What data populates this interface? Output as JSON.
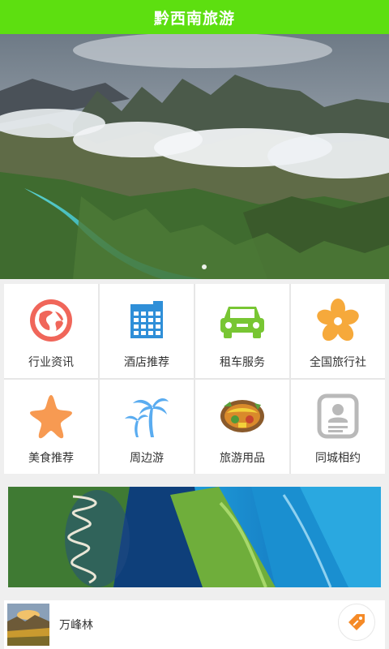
{
  "header": {
    "title": "黔西南旅游"
  },
  "banner": {
    "pager_active": 1
  },
  "categories": [
    {
      "label": "行业资讯",
      "icon": "globe-icon"
    },
    {
      "label": "酒店推荐",
      "icon": "hotel-building-icon"
    },
    {
      "label": "租车服务",
      "icon": "car-icon"
    },
    {
      "label": "全国旅行社",
      "icon": "flower-icon"
    },
    {
      "label": "美食推荐",
      "icon": "starfish-icon"
    },
    {
      "label": "周边游",
      "icon": "palm-tree-icon"
    },
    {
      "label": "旅游用品",
      "icon": "travel-goods-icon"
    },
    {
      "label": "同城相约",
      "icon": "id-card-icon"
    }
  ],
  "list": [
    {
      "title": "万峰林",
      "thumb": "landscape-thumbnail",
      "action_icon": "price-tag-icon"
    }
  ],
  "colors": {
    "header_bg": "#5ddf10",
    "globe": "#f0665a",
    "hotel": "#2f8fd8",
    "car": "#78c633",
    "flower": "#f6a93b",
    "starfish": "#f79a52",
    "palm": "#5aacf0",
    "idcard": "#b9b9b9",
    "tag": "#f58a27"
  }
}
